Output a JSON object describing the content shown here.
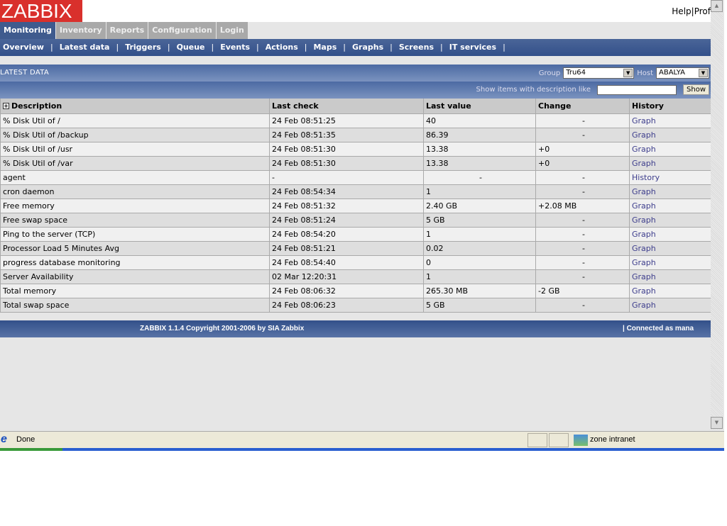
{
  "logo": "ZABBIX",
  "top_links": [
    "Help",
    "Profile"
  ],
  "tabs": [
    "Monitoring",
    "Inventory",
    "Reports",
    "Configuration",
    "Login"
  ],
  "subnav": [
    "Overview",
    "Latest data",
    "Triggers",
    "Queue",
    "Events",
    "Actions",
    "Maps",
    "Graphs",
    "Screens",
    "IT services"
  ],
  "section_title": "LATEST DATA",
  "group_label": "Group",
  "group_value": "Tru64",
  "host_label": "Host",
  "host_value": "ABALYA",
  "filter_label": "Show items with description like",
  "filter_value": "",
  "show_button": "Show",
  "columns": [
    "Description",
    "Last check",
    "Last value",
    "Change",
    "History"
  ],
  "rows": [
    [
      "% Disk Util of /",
      "24 Feb 08:51:25",
      "40",
      "-",
      "Graph"
    ],
    [
      "% Disk Util of /backup",
      "24 Feb 08:51:35",
      "86.39",
      "-",
      "Graph"
    ],
    [
      "% Disk Util of /usr",
      "24 Feb 08:51:30",
      "13.38",
      "+0",
      "Graph"
    ],
    [
      "% Disk Util of /var",
      "24 Feb 08:51:30",
      "13.38",
      "+0",
      "Graph"
    ],
    [
      "agent",
      "-",
      "-",
      "-",
      "History"
    ],
    [
      "cron daemon",
      "24 Feb 08:54:34",
      "1",
      "-",
      "Graph"
    ],
    [
      "Free memory",
      "24 Feb 08:51:32",
      "2.40 GB",
      "+2.08 MB",
      "Graph"
    ],
    [
      "Free swap space",
      "24 Feb 08:51:24",
      "5 GB",
      "-",
      "Graph"
    ],
    [
      "Ping to the server (TCP)",
      "24 Feb 08:54:20",
      "1",
      "-",
      "Graph"
    ],
    [
      "Processor Load 5 Minutes Avg",
      "24 Feb 08:51:21",
      "0.02",
      "-",
      "Graph"
    ],
    [
      "progress database monitoring",
      "24 Feb 08:54:40",
      "0",
      "-",
      "Graph"
    ],
    [
      "Server Availability",
      "02 Mar 12:20:31",
      "1",
      "-",
      "Graph"
    ],
    [
      "Total memory",
      "24 Feb 08:06:32",
      "265.30 MB",
      "-2 GB",
      "Graph"
    ],
    [
      "Total swap space",
      "24 Feb 08:06:23",
      "5 GB",
      "-",
      "Graph"
    ]
  ],
  "footer": {
    "copyright": "ZABBIX 1.1.4 Copyright 2001-2006 by  SIA Zabbix",
    "connected": "|  Connected as mana"
  },
  "status": {
    "text": "Done",
    "zone": "zone intranet"
  }
}
